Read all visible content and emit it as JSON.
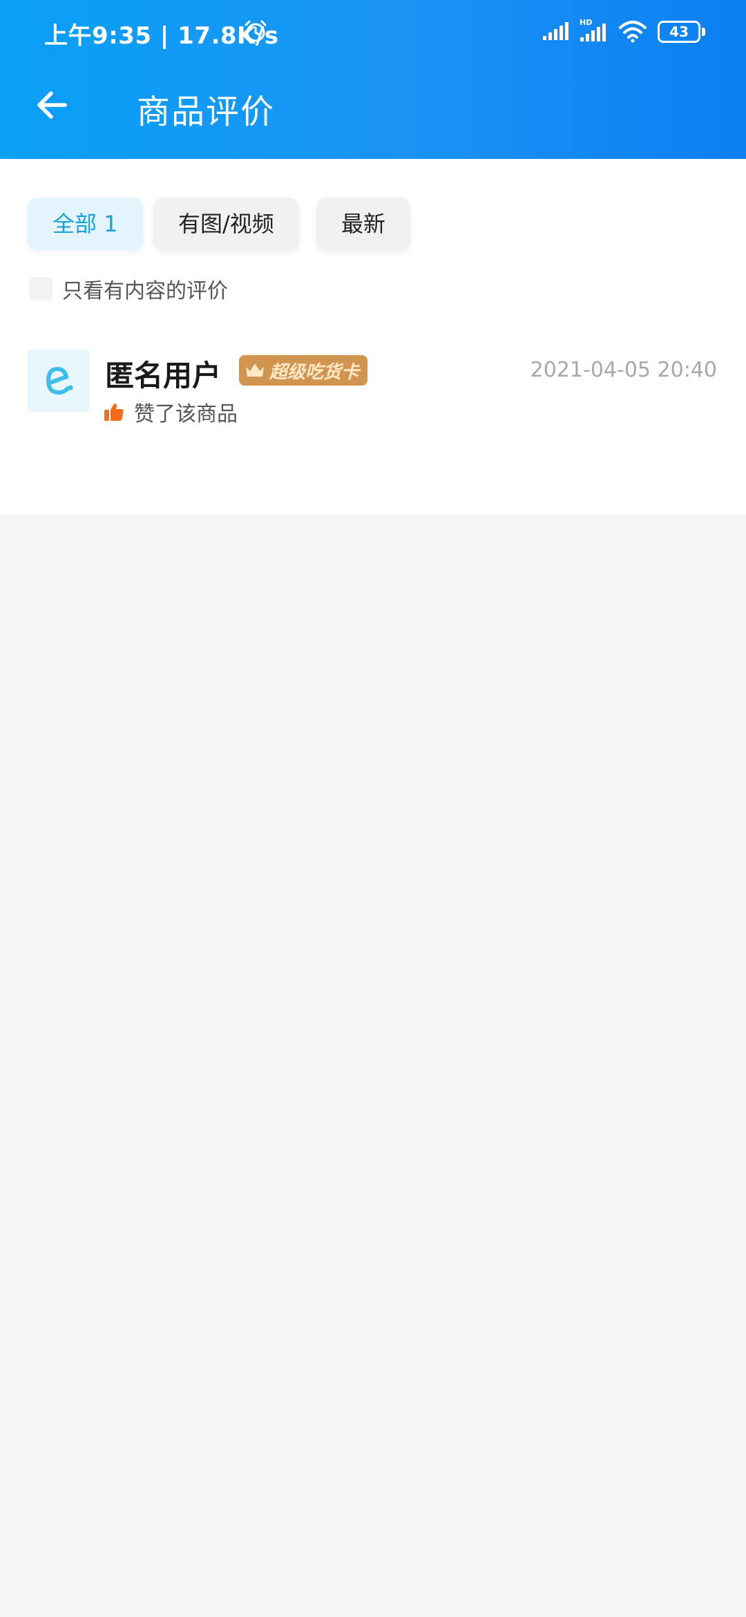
{
  "status_bar": {
    "time": "上午9:35 | 17.8K/s",
    "signal_hd_label": "HD",
    "battery": "43",
    "icons": [
      "alarm-icon",
      "signal-icon",
      "signal-hd-icon",
      "wifi-icon",
      "battery-icon"
    ]
  },
  "header": {
    "title": "商品评价",
    "back_icon": "arrow-left-icon",
    "gradient_colors": [
      "#0aa0f6",
      "#0b7ff2"
    ]
  },
  "tabs": [
    {
      "label": "全部 1",
      "active": true
    },
    {
      "label": "有图/视频",
      "active": false
    },
    {
      "label": "最新",
      "active": false
    }
  ],
  "filter": {
    "label": "只看有内容的评价",
    "checked": false
  },
  "review": {
    "username": "匿名用户",
    "badge": "超级吃货卡",
    "badge_icon": "crown-icon",
    "timestamp": "2021-04-05 20:40",
    "like_text": "赞了该商品",
    "like_icon": "thumbs-up-icon",
    "avatar_icon": "eleme-logo-icon"
  },
  "colors": {
    "accent": "#1aa3d8",
    "badge": "#d2954f",
    "like": "#f46c1e"
  }
}
